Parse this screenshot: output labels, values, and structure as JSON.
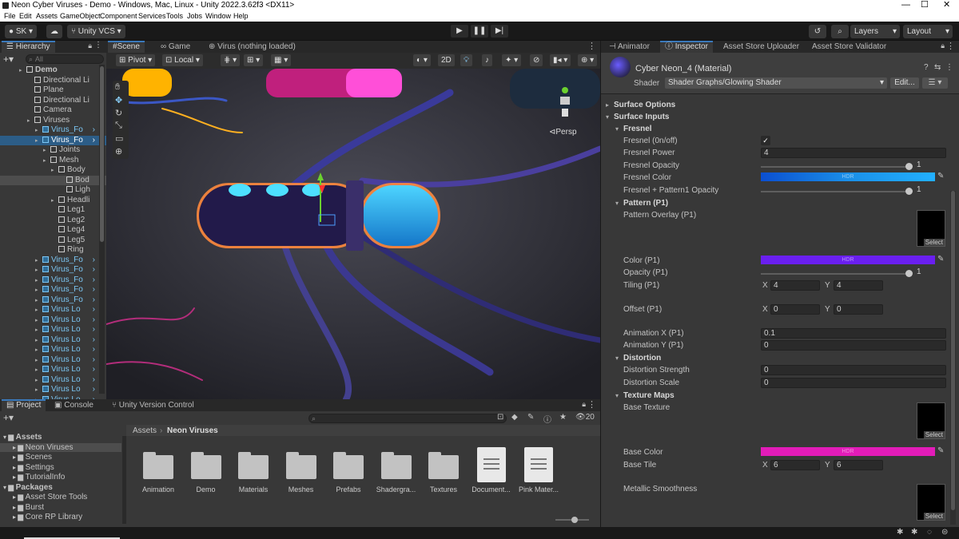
{
  "window": {
    "title": "Neon Cyber Viruses - Demo - Windows, Mac, Linux - Unity 2022.3.62f3 <DX11>"
  },
  "menu": [
    "File",
    "Edit",
    "Assets",
    "GameObject",
    "Component",
    "Services",
    "Tools",
    "Jobs",
    "Window",
    "Help"
  ],
  "toolbar": {
    "account": "SK",
    "vcs": "Unity VCS",
    "layers": "Layers",
    "layout": "Layout"
  },
  "hierarchy": {
    "tab": "Hierarchy",
    "search_placeholder": "All",
    "rows": [
      "Demo",
      "Directional Li",
      "Plane",
      "Directional Li",
      "Camera",
      "Viruses",
      "Virus_Fo",
      "Virus_Fo",
      "Joints",
      "Mesh",
      "Body",
      "Bod",
      "Ligh",
      "Headli",
      "Leg1",
      "Leg2",
      "Leg4",
      "Leg5",
      "Ring",
      "Virus_Fo",
      "Virus_Fo",
      "Virus_Fo",
      "Virus_Fo",
      "Virus_Fo",
      "Virus Lo",
      "Virus Lo",
      "Virus Lo",
      "Virus Lo",
      "Virus Lo",
      "Virus Lo",
      "Virus Lo",
      "Virus Lo",
      "Virus Lo",
      "Virus Lo"
    ]
  },
  "scene": {
    "tabs": [
      "Scene",
      "Game",
      "Virus (nothing loaded)"
    ],
    "pivot": "Pivot",
    "local": "Local",
    "mode2d": "2D",
    "persp": "Persp"
  },
  "inspector": {
    "tabs": [
      "Animator",
      "Inspector",
      "Asset Store Uploader",
      "Asset Store Validator"
    ],
    "material": "Cyber Neon_4 (Material)",
    "shader_label": "Shader",
    "shader": "Shader Graphs/Glowing Shader",
    "edit": "Edit...",
    "sections": {
      "surface_options": "Surface Options",
      "surface_inputs": "Surface Inputs",
      "fresnel": "Fresnel",
      "pattern": "Pattern (P1)",
      "distortion": "Distortion",
      "texture_maps": "Texture Maps"
    },
    "fields": {
      "fresnel_onoff": "Fresnel (0n/off)",
      "fresnel_power": "Fresnel Power",
      "fresnel_power_val": "4",
      "fresnel_opacity": "Fresnel Opacity",
      "fresnel_opacity_val": "1",
      "fresnel_color": "Fresnel Color",
      "fresnel_pattern_opacity": "Fresnel + Pattern1 Opacity",
      "fresnel_pattern_opacity_val": "1",
      "pattern_overlay": "Pattern Overlay (P1)",
      "color_p1": "Color (P1)",
      "hdr": "HDR",
      "opacity_p1": "Opacity (P1)",
      "opacity_p1_val": "1",
      "tiling_p1": "Tiling (P1)",
      "tiling_x": "4",
      "tiling_y": "4",
      "offset_p1": "Offset (P1)",
      "offset_x": "0",
      "offset_y": "0",
      "anim_x": "Animation X (P1)",
      "anim_x_val": "0.1",
      "anim_y": "Animation Y (P1)",
      "anim_y_val": "0",
      "dist_strength": "Distortion Strength",
      "dist_strength_val": "0",
      "dist_scale": "Distortion Scale",
      "dist_scale_val": "0",
      "base_texture": "Base Texture",
      "base_color": "Base Color",
      "base_tile": "Base Tile",
      "base_tile_x": "6",
      "base_tile_y": "6",
      "metallic": "Metallic Smoothness",
      "select": "Select",
      "x": "X",
      "y": "Y"
    }
  },
  "project": {
    "tabs": [
      "Project",
      "Console",
      "Unity Version Control"
    ],
    "tree": [
      "Assets",
      "Neon Viruses",
      "Scenes",
      "Settings",
      "TutorialInfo",
      "Packages",
      "Asset Store Tools",
      "Burst",
      "Core RP Library"
    ],
    "breadcrumb": [
      "Assets",
      "Neon Viruses"
    ],
    "count": "20",
    "assets": [
      "Animation",
      "Demo",
      "Materials",
      "Meshes",
      "Prefabs",
      "Shadergra...",
      "Textures",
      "Document...",
      "Pink Mater..."
    ]
  },
  "colors": {
    "fresnel": "#1a8fe8",
    "pattern": "#6a1ff0",
    "base": "#e21cb8",
    "accent": "#3a79bb"
  }
}
